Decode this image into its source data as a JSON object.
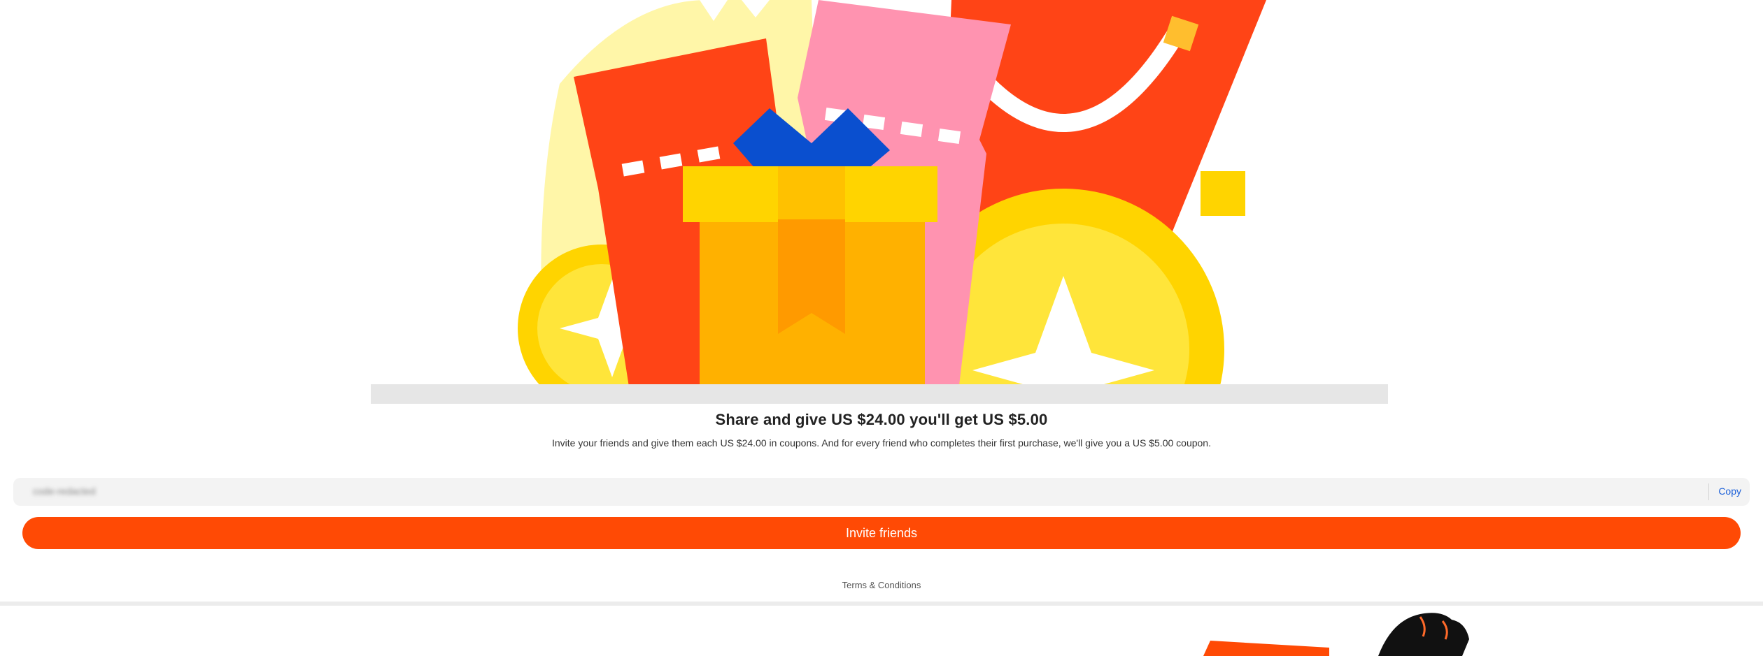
{
  "hero": {
    "illustration": "gift-coupons-coins-illustration",
    "colors": {
      "red": "#ff4416",
      "pink": "#ff93b0",
      "yellow": "#ffd400",
      "gold": "#ffb100",
      "blue": "#0a4fcf",
      "pale_yellow": "#fff6a8"
    }
  },
  "headline": "Share and give US $24.00 you'll get US $5.00",
  "subtext": "Invite your friends and give them each US $24.00 in coupons. And for every friend who completes their first purchase, we'll give you a US $5.00 coupon.",
  "share_link": {
    "value": "code-redacted",
    "copy_label": "Copy"
  },
  "invite_button": {
    "label": "Invite friends",
    "color": "#ff4a05"
  },
  "terms_link": "Terms & Conditions"
}
